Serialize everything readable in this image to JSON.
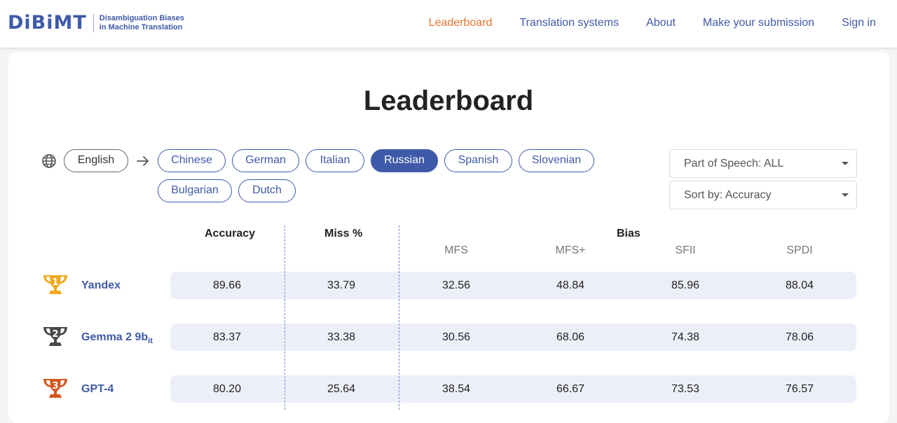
{
  "header": {
    "logo_text": "DiBiMT",
    "logo_sub_line1": "Disambiguation Biases",
    "logo_sub_line2": "in Machine Translation",
    "nav": [
      {
        "label": "Leaderboard"
      },
      {
        "label": "Translation systems"
      },
      {
        "label": "About"
      },
      {
        "label": "Make your submission"
      },
      {
        "label": "Sign in"
      }
    ],
    "active_color": "#e8722d",
    "accent_color": "#3f5aa8"
  },
  "main": {
    "title": "Leaderboard",
    "source_language": "English",
    "target_languages": [
      {
        "label": "Chinese"
      },
      {
        "label": "German"
      },
      {
        "label": "Italian"
      },
      {
        "label": "Russian",
        "selected": true
      },
      {
        "label": "Spanish"
      },
      {
        "label": "Slovenian"
      },
      {
        "label": "Bulgarian"
      },
      {
        "label": "Dutch"
      }
    ],
    "filters": {
      "part_of_speech": "Part of Speech: ALL",
      "sort_by": "Sort by: Accuracy"
    }
  },
  "table": {
    "headers": {
      "accuracy": "Accuracy",
      "miss": "Miss %",
      "bias": "Bias",
      "bias_sub": [
        "MFS",
        "MFS+",
        "SFII",
        "SPDI"
      ]
    },
    "rows": [
      {
        "rank": "1",
        "name": "Yandex",
        "name_sub": "",
        "values": [
          "89.66",
          "33.79",
          "32.56",
          "48.84",
          "85.96",
          "88.04"
        ]
      },
      {
        "rank": "2",
        "name": "Gemma 2 9b",
        "name_sub": "it",
        "values": [
          "83.37",
          "33.38",
          "30.56",
          "68.06",
          "74.38",
          "78.06"
        ]
      },
      {
        "rank": "3",
        "name": "GPT-4",
        "name_sub": "",
        "values": [
          "80.20",
          "25.64",
          "38.54",
          "66.67",
          "73.53",
          "76.57"
        ]
      }
    ]
  }
}
